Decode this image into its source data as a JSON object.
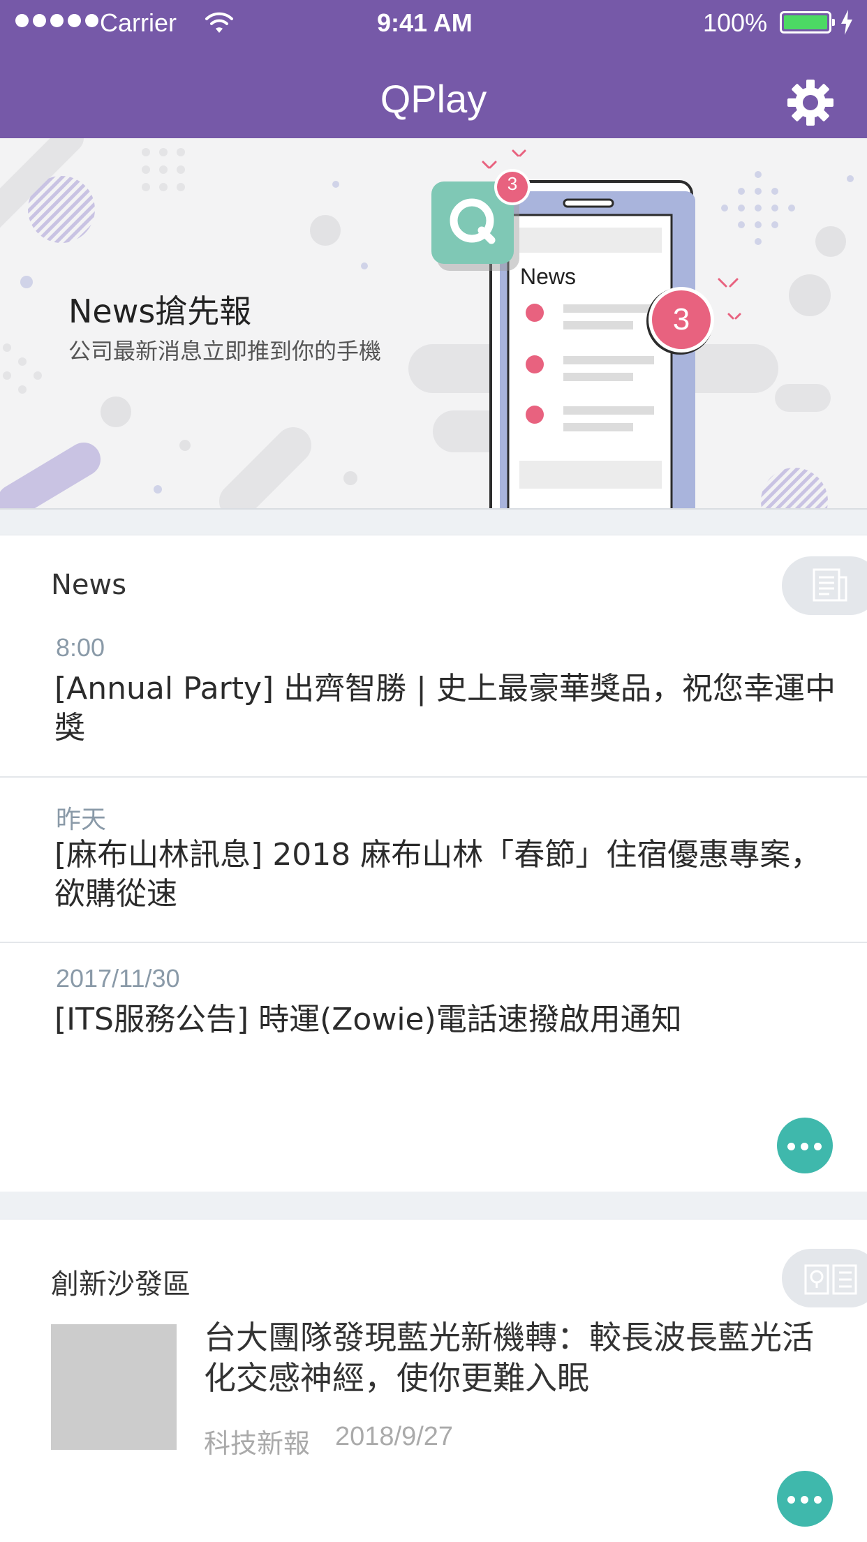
{
  "status_bar": {
    "carrier": "Carrier",
    "time": "9:41 AM",
    "battery": "100%",
    "battery_level": 1.0
  },
  "nav": {
    "title": "QPlay",
    "settings_icon": "gear-icon"
  },
  "banner": {
    "title": "News搶先報",
    "subtitle": "公司最新消息立即推到你的手機",
    "phone_label": "News",
    "badge_small": "3",
    "badge_large": "3",
    "app_icon_letter": "Q"
  },
  "news_section": {
    "heading": "News",
    "icon": "newspaper-icon",
    "items": [
      {
        "time": "8:00",
        "title": "[Annual Party] 出齊智勝 | 史上最豪華獎品，祝您幸運中獎"
      },
      {
        "time": "昨天",
        "title": "[麻布山林訊息] 2018 麻布山林「春節」住宿優惠專案，欲購從速"
      },
      {
        "time": "2017/11/30",
        "title": "[ITS服務公告] 時運(Zowie)電話速撥啟用通知"
      }
    ],
    "more_icon": "more-dots-icon"
  },
  "sofa_section": {
    "heading": "創新沙發區",
    "icon": "idea-book-icon",
    "item": {
      "title": "台大團隊發現藍光新機轉：較長波長藍光活化交感神經，使你更難入眠",
      "source": "科技新報",
      "date": "2018/9/27"
    },
    "more_icon": "more-dots-icon"
  },
  "colors": {
    "header": "#7659a8",
    "accent": "#3fb8ac",
    "badge": "#e8627f",
    "app_icon": "#7fc8b5"
  }
}
